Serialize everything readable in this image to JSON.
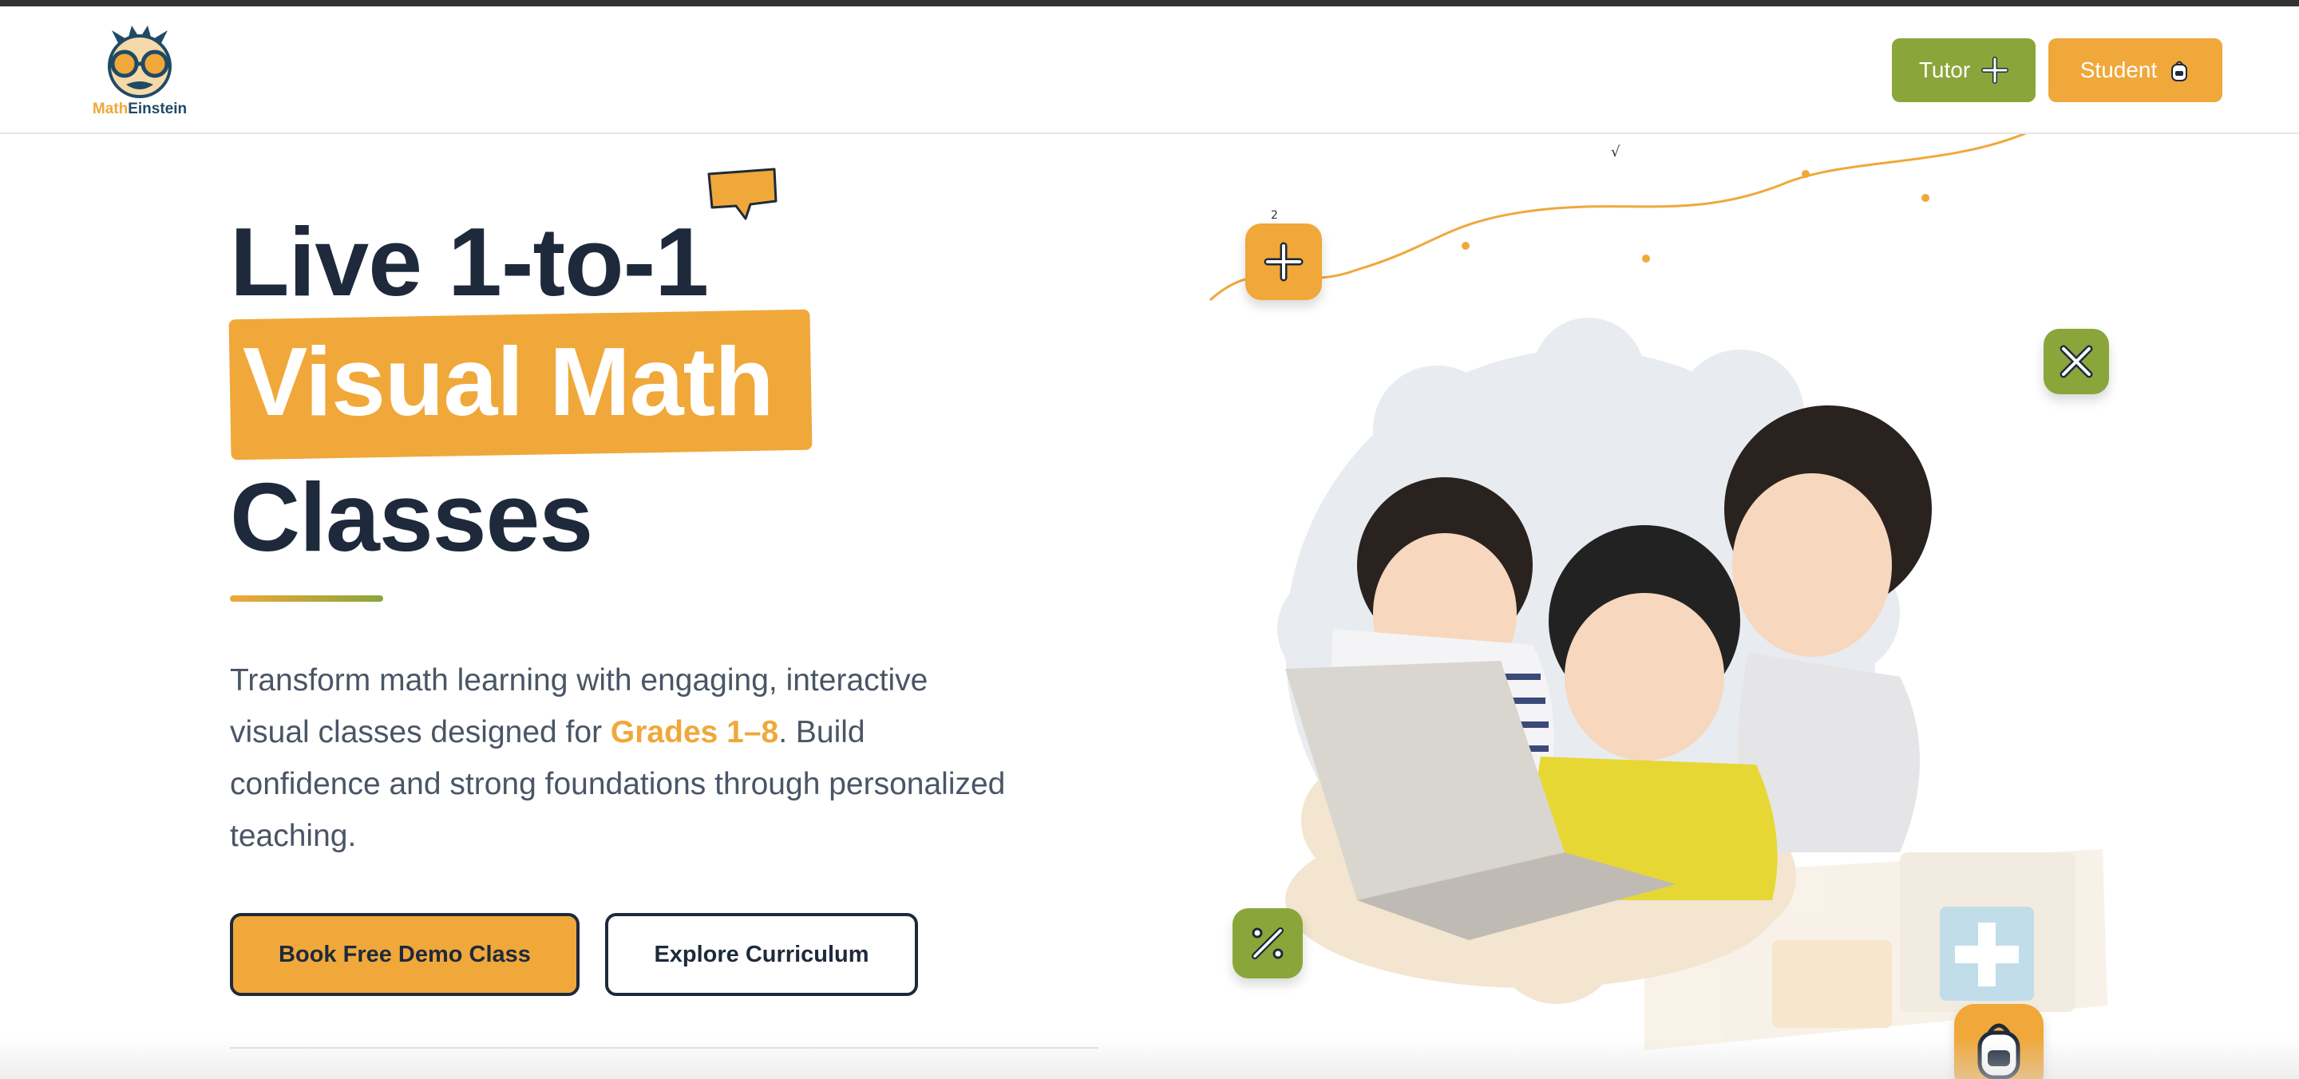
{
  "header": {
    "logo": {
      "word1": "Math",
      "word2": "Einstein"
    },
    "nav": [
      {
        "label": "Tutor",
        "icon": "plus-icon"
      },
      {
        "label": "Student",
        "icon": "backpack-icon"
      }
    ]
  },
  "hero": {
    "title_line1": "Live 1-to-1",
    "title_line2": "Visual Math",
    "title_line3": "Classes",
    "paragraph_before": "Transform math learning with engaging, interactive visual classes designed for ",
    "paragraph_highlight": "Grades 1–8",
    "paragraph_after": ". Build confidence and strong foundations through personalized teaching.",
    "primary_cta": "Book Free Demo Class",
    "secondary_cta": "Explore Curriculum"
  },
  "decorations": {
    "icons": [
      "plus-icon",
      "times-icon",
      "percent-icon",
      "backpack-icon",
      "speech-bubble-icon"
    ],
    "sketch_symbols": [
      "2",
      "√"
    ]
  },
  "colors": {
    "accent_orange": "#f0a83a",
    "accent_green": "#8aa63a",
    "navy": "#1e2a3b",
    "body_text": "#4a5566"
  }
}
